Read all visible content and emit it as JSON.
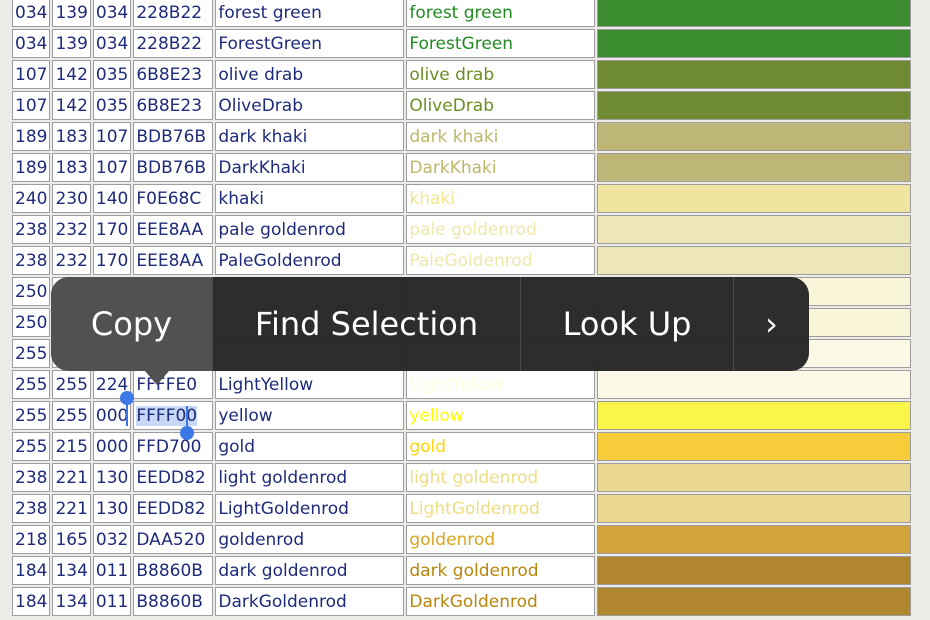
{
  "rows": [
    {
      "r": "034",
      "g": "139",
      "b": "034",
      "hex": "228B22",
      "name": "forest green",
      "color": "#228B22",
      "swatch": "#3a8c2e"
    },
    {
      "r": "034",
      "g": "139",
      "b": "034",
      "hex": "228B22",
      "name": "ForestGreen",
      "color": "#228B22",
      "swatch": "#3a8c2e"
    },
    {
      "r": "107",
      "g": "142",
      "b": "035",
      "hex": "6B8E23",
      "name": "olive drab",
      "color": "#6B8E23",
      "swatch": "#6e8a32"
    },
    {
      "r": "107",
      "g": "142",
      "b": "035",
      "hex": "6B8E23",
      "name": "OliveDrab",
      "color": "#6B8E23",
      "swatch": "#6e8a32"
    },
    {
      "r": "189",
      "g": "183",
      "b": "107",
      "hex": "BDB76B",
      "name": "dark khaki",
      "color": "#BDB76B",
      "swatch": "#bdb676"
    },
    {
      "r": "189",
      "g": "183",
      "b": "107",
      "hex": "BDB76B",
      "name": "DarkKhaki",
      "color": "#BDB76B",
      "swatch": "#bdb676"
    },
    {
      "r": "240",
      "g": "230",
      "b": "140",
      "hex": "F0E68C",
      "name": "khaki",
      "color": "#F0E68C",
      "swatch": "#efe5a0"
    },
    {
      "r": "238",
      "g": "232",
      "b": "170",
      "hex": "EEE8AA",
      "name": "pale goldenrod",
      "color": "#EEE8AA",
      "swatch": "#ede6b8"
    },
    {
      "r": "238",
      "g": "232",
      "b": "170",
      "hex": "EEE8AA",
      "name": "PaleGoldenrod",
      "color": "#EEE8AA",
      "swatch": "#ede6b8"
    },
    {
      "r": "250",
      "g": "",
      "b": "",
      "hex": "",
      "name": "",
      "color": "#FAFAD2",
      "swatch": "#f8f5d8"
    },
    {
      "r": "250",
      "g": "",
      "b": "",
      "hex": "",
      "name": "",
      "color": "#FAFAD2",
      "swatch": "#f8f5d8"
    },
    {
      "r": "255",
      "g": "",
      "b": "",
      "hex": "",
      "name": "",
      "color": "#FFFFE0",
      "swatch": "#fbf9e6"
    },
    {
      "r": "255",
      "g": "255",
      "b": "224",
      "hex": "FFFFE0",
      "name": "LightYellow",
      "color": "#FFFFE0",
      "swatch": "#fbf9e6"
    },
    {
      "r": "255",
      "g": "255",
      "b": "000",
      "hex": "FFFF00",
      "name": "yellow",
      "color": "#FFFF00",
      "swatch": "#f9f54a"
    },
    {
      "r": "255",
      "g": "215",
      "b": "000",
      "hex": "FFD700",
      "name": "gold",
      "color": "#FFD700",
      "swatch": "#f6cc3a"
    },
    {
      "r": "238",
      "g": "221",
      "b": "130",
      "hex": "EEDD82",
      "name": "light goldenrod",
      "color": "#EEDD82",
      "swatch": "#ebd890"
    },
    {
      "r": "238",
      "g": "221",
      "b": "130",
      "hex": "EEDD82",
      "name": "LightGoldenrod",
      "color": "#EEDD82",
      "swatch": "#ebd890"
    },
    {
      "r": "218",
      "g": "165",
      "b": "032",
      "hex": "DAA520",
      "name": "goldenrod",
      "color": "#DAA520",
      "swatch": "#d2a33a"
    },
    {
      "r": "184",
      "g": "134",
      "b": "011",
      "hex": "B8860B",
      "name": "dark goldenrod",
      "color": "#B8860B",
      "swatch": "#b0862e"
    },
    {
      "r": "184",
      "g": "134",
      "b": "011",
      "hex": "B8860B",
      "name": "DarkGoldenrod",
      "color": "#B8860B",
      "swatch": "#b0862e"
    }
  ],
  "menu": {
    "copy": "Copy",
    "find_selection": "Find Selection",
    "look_up": "Look Up",
    "more": "›"
  },
  "selection_text": "FFFF00"
}
